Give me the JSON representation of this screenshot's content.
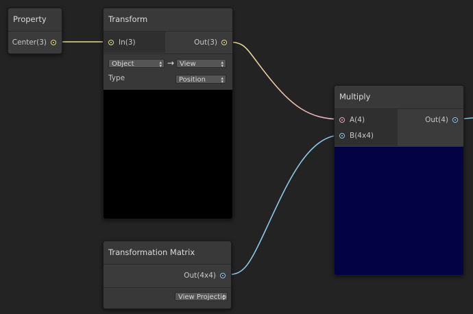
{
  "nodes": {
    "property": {
      "title": "Property",
      "output": "Center(3)"
    },
    "transform": {
      "title": "Transform",
      "input": "In(3)",
      "output": "Out(3)",
      "from_space": "Object",
      "arrow": "→",
      "to_space": "View",
      "type_label": "Type",
      "type_value": "Position"
    },
    "transformation_matrix": {
      "title": "Transformation Matrix",
      "output": "Out(4x4)",
      "matrix_value": "View Projection"
    },
    "multiply": {
      "title": "Multiply",
      "input_a": "A(4)",
      "input_b": "B(4x4)",
      "output": "Out(4)"
    }
  },
  "colors": {
    "background": "#232323",
    "vector3_wire": "#e6e28a",
    "vector4_wire": "#e8a8c8",
    "matrix_wire": "#8ccbe6",
    "transform_preview": "#000000",
    "multiply_preview": "#020244"
  },
  "icons": {
    "dropdown": "dropdown-arrow-icon",
    "port": "port-dot-icon"
  }
}
